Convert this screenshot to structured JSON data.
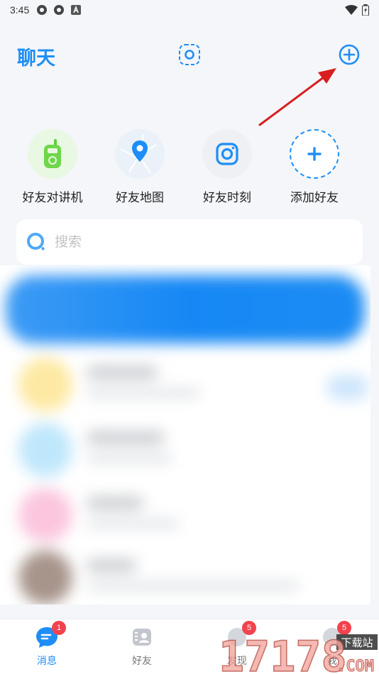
{
  "status_bar": {
    "time": "3:45"
  },
  "header": {
    "title": "聊天"
  },
  "quick_actions": [
    {
      "label": "好友对讲机",
      "icon": "walkie-talkie-icon"
    },
    {
      "label": "好友地图",
      "icon": "map-pin-icon"
    },
    {
      "label": "好友时刻",
      "icon": "camera-moment-icon"
    },
    {
      "label": "添加好友",
      "icon": "plus-icon"
    }
  ],
  "search": {
    "placeholder": "搜索"
  },
  "tabs": [
    {
      "label": "消息",
      "badge": "1",
      "active": true
    },
    {
      "label": "好友",
      "badge": ""
    },
    {
      "label": "发现",
      "badge": "5"
    },
    {
      "label": "我",
      "badge": "5"
    }
  ],
  "watermark": {
    "top_text": "下载站",
    "digits": "17178",
    "suffix": ".COM"
  },
  "colors": {
    "accent": "#1e8ef6",
    "badge": "#f2424d",
    "arrow": "#d81e1e"
  }
}
